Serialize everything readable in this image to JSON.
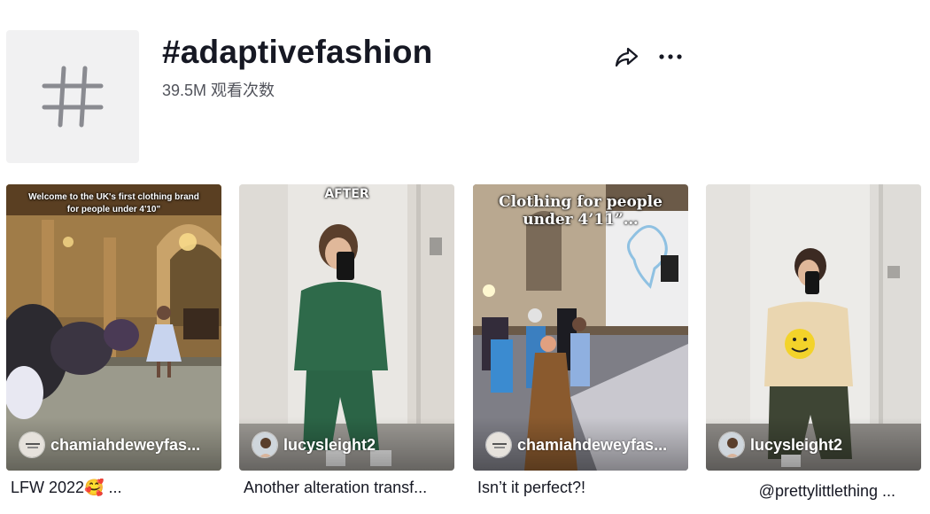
{
  "header": {
    "title": "#adaptivefashion",
    "views": "39.5M 观看次数",
    "hash_icon": "hashtag-icon",
    "share_icon": "share-icon",
    "more_icon": "more-horizontal-icon"
  },
  "videos": [
    {
      "overlay_text": "Welcome to the UK's first clothing brand for people under 4'10\"",
      "author": "chamiahdeweyfas...",
      "caption": "LFW 2022🥰 ..."
    },
    {
      "overlay_text": "AFTER",
      "author": "lucysleight2",
      "caption": "Another alteration transf..."
    },
    {
      "overlay_text": "Clothing for people under 4’11”…",
      "author": "chamiahdeweyfas...",
      "caption": "Isn’t it perfect?!"
    },
    {
      "overlay_text": "",
      "author": "lucysleight2",
      "caption": "ﾠﾠﾠ @prettylittlething ..."
    }
  ],
  "colors": {
    "text": "#161823",
    "tile": "#f1f1f2",
    "muted": "#8a8b91"
  }
}
